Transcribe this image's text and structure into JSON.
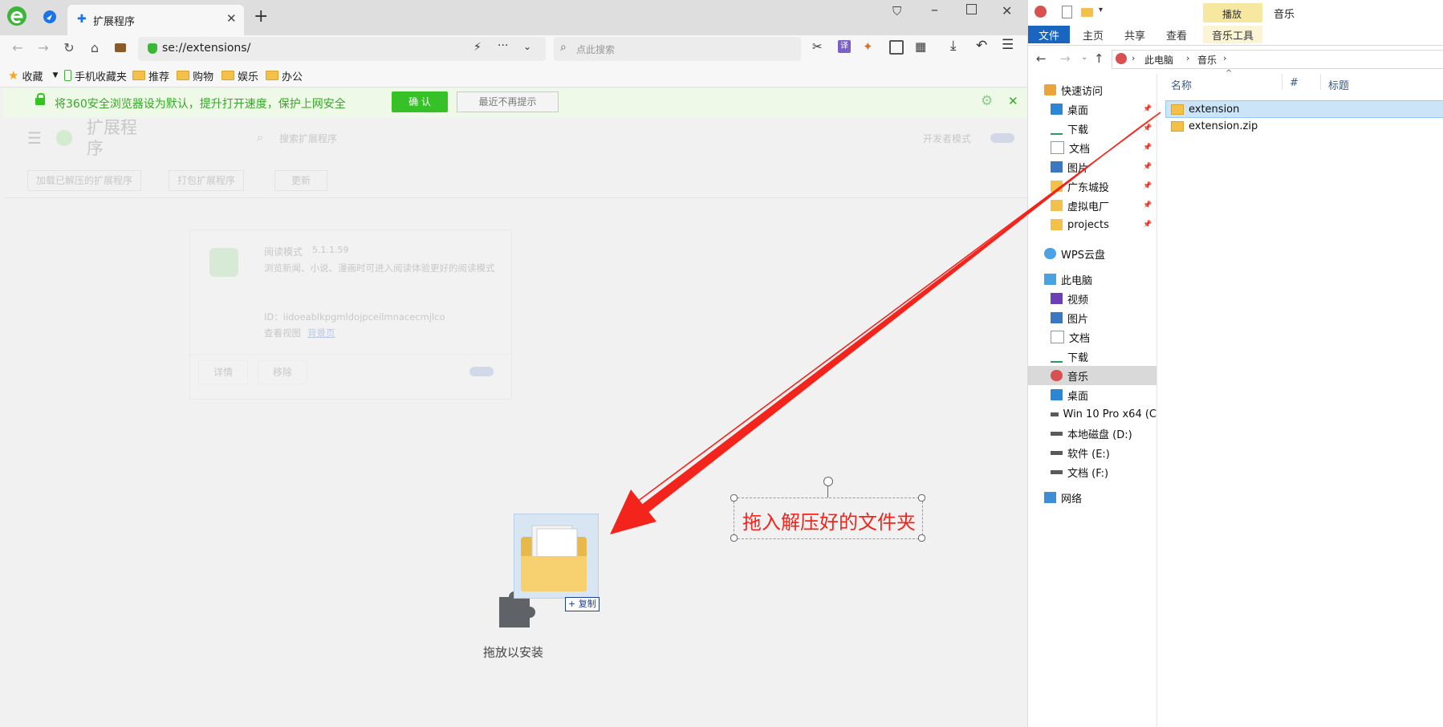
{
  "browser": {
    "tab_title": "扩展程序",
    "new_tab_symbol": "+",
    "address": "se://extensions/",
    "search_placeholder": "点此搜索",
    "translate_badge": "译",
    "bookmarks": [
      "收藏",
      "手机收藏夹",
      "推荐",
      "购物",
      "娱乐",
      "办公"
    ],
    "infobar": {
      "message": "将360安全浏览器设为默认，提升打开速度，保护上网安全",
      "confirm_label": "确 认",
      "dismiss_label": "最近不再提示"
    },
    "extensions_page": {
      "title": "扩展程序",
      "search_placeholder": "搜索扩展程序",
      "dev_mode_label": "开发者模式",
      "toolbar": [
        "加载已解压的扩展程序",
        "打包扩展程序",
        "更新"
      ],
      "card": {
        "name": "阅读模式",
        "version": "5.1.1.59",
        "description": "浏览新闻、小说、漫画时可进入阅读体验更好的阅读模式",
        "id_line": "ID：iidoeablkpgmldojpceilmnacecmjlco",
        "view_label": "查看视图",
        "view_link": "背景页",
        "details_label": "详情",
        "remove_label": "移除"
      },
      "drop_label": "拖放以安装",
      "copy_badge": "+ 复制"
    },
    "annotation": "拖入解压好的文件夹",
    "colors": {
      "accent_green": "#36c226",
      "arrow_red": "#f2241b"
    }
  },
  "explorer": {
    "ribbon_tabs": [
      "文件",
      "主页",
      "共享",
      "查看"
    ],
    "context_tab_header": "播放",
    "context_tab": "音乐工具",
    "window_title": "音乐",
    "breadcrumb": [
      "此电脑",
      "音乐"
    ],
    "columns": [
      "名称",
      "#",
      "标题"
    ],
    "nav": [
      {
        "label": "快速访问",
        "icon": "star-icon",
        "level": 0
      },
      {
        "label": "桌面",
        "icon": "desktop-icon",
        "level": 1,
        "pinned": true
      },
      {
        "label": "下载",
        "icon": "download-icon",
        "level": 1,
        "pinned": true
      },
      {
        "label": "文档",
        "icon": "document-icon",
        "level": 1,
        "pinned": true
      },
      {
        "label": "图片",
        "icon": "picture-icon",
        "level": 1,
        "pinned": true
      },
      {
        "label": "广东城投",
        "icon": "folder-icon",
        "level": 1,
        "pinned": true
      },
      {
        "label": "虚拟电厂",
        "icon": "folder-icon",
        "level": 1,
        "pinned": true
      },
      {
        "label": "projects",
        "icon": "folder-icon",
        "level": 1,
        "pinned": true
      },
      {
        "label": "WPS云盘",
        "icon": "cloud-icon",
        "level": 0
      },
      {
        "label": "此电脑",
        "icon": "pc-icon",
        "level": 0
      },
      {
        "label": "视频",
        "icon": "video-icon",
        "level": 1
      },
      {
        "label": "图片",
        "icon": "picture-icon",
        "level": 1
      },
      {
        "label": "文档",
        "icon": "document-icon",
        "level": 1
      },
      {
        "label": "下载",
        "icon": "download-icon",
        "level": 1
      },
      {
        "label": "音乐",
        "icon": "music-icon",
        "level": 1,
        "selected": true
      },
      {
        "label": "桌面",
        "icon": "desktop-icon",
        "level": 1
      },
      {
        "label": "Win 10 Pro x64 (C",
        "icon": "drive-icon",
        "level": 1
      },
      {
        "label": "本地磁盘 (D:)",
        "icon": "drive-icon",
        "level": 1
      },
      {
        "label": "软件 (E:)",
        "icon": "drive-icon",
        "level": 1
      },
      {
        "label": "文档 (F:)",
        "icon": "drive-icon",
        "level": 1
      },
      {
        "label": "网络",
        "icon": "network-icon",
        "level": 0
      }
    ],
    "files": [
      {
        "name": "extension",
        "icon": "folder-icon",
        "selected": true
      },
      {
        "name": "extension.zip",
        "icon": "zip-folder-icon",
        "selected": false
      }
    ]
  }
}
